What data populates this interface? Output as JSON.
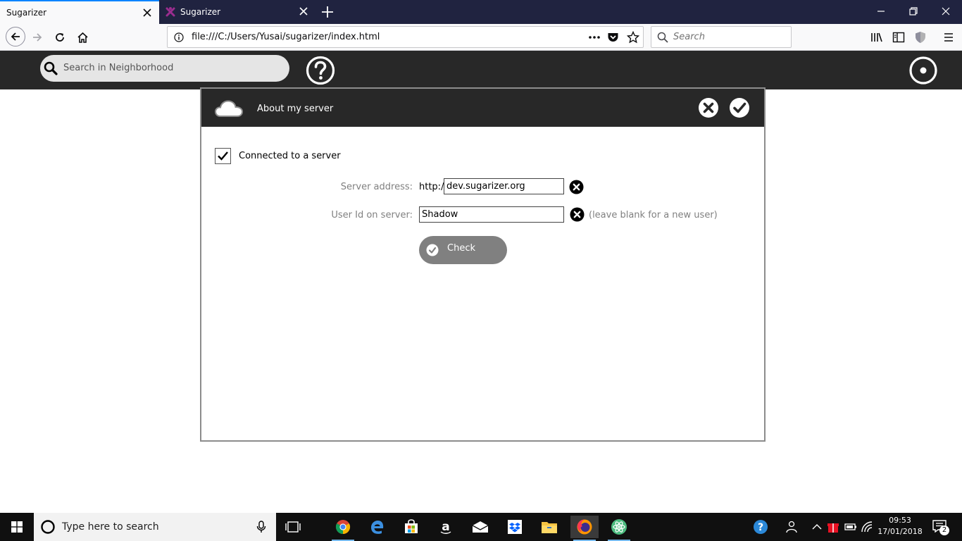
{
  "browser": {
    "tabs": [
      {
        "title": "Sugarizer",
        "active": true
      },
      {
        "title": "Sugarizer",
        "active": false
      }
    ],
    "url": "file:///C:/Users/Yusai/sugarizer/index.html",
    "search_placeholder": "Search"
  },
  "toolbar": {
    "search_placeholder": "Search in Neighborhood"
  },
  "dialog": {
    "title": "About my server",
    "connected_label": "Connected to a server",
    "connected": true,
    "server_address_label": "Server address:",
    "server_prefix": "http://",
    "server_address_value": "dev.sugarizer.org",
    "user_id_label": "User Id on server:",
    "user_id_value": "Shadow",
    "user_id_hint": "(leave blank for a new user)",
    "check_button_label": "Check"
  },
  "taskbar": {
    "search_placeholder": "Type here to search",
    "time": "09:53",
    "date": "17/01/2018",
    "notification_count": "2",
    "apps": [
      "chrome-icon",
      "edge-icon",
      "store-icon",
      "amazon-icon",
      "mail-icon",
      "dropbox-icon",
      "file-explorer-icon",
      "firefox-icon",
      "atom-icon"
    ]
  },
  "colors": {
    "toolbar_bg": "#282828",
    "tabstrip_bg": "#202340",
    "accent_blue": "#0a84ff",
    "check_button_bg": "#808080"
  }
}
